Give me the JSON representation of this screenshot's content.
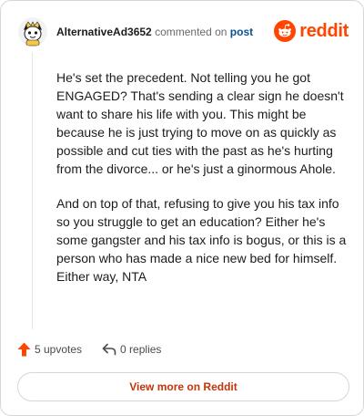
{
  "header": {
    "author": "AlternativeAd3652",
    "commented_on": "commented on",
    "post_link": "post",
    "logo_text": "reddit"
  },
  "comment": {
    "paragraphs": [
      "He's set the precedent. Not telling you he got ENGAGED? That's sending a clear sign he doesn't want to share his life with you. This might be because he is just trying to move on as quickly as possible and cut ties with the past as he's hurting from the divorce... or he's just a ginormous Ahole.",
      "And on top of that, refusing to give you his tax info so you struggle to get an education? Either he's some gangster and his tax info is bogus, or this is a person who has made a nice new bed for himself. Either way, NTA"
    ]
  },
  "actions": {
    "upvotes": "5 upvotes",
    "replies": "0 replies"
  },
  "footer": {
    "view_more": "View more on Reddit"
  },
  "colors": {
    "brand": "#ff4500",
    "link": "#0a4f8f",
    "button_text": "#c2350a"
  },
  "icons": [
    "avatar-illustration",
    "reddit-logo-icon",
    "upvote-arrow-icon",
    "reply-arrow-icon"
  ]
}
